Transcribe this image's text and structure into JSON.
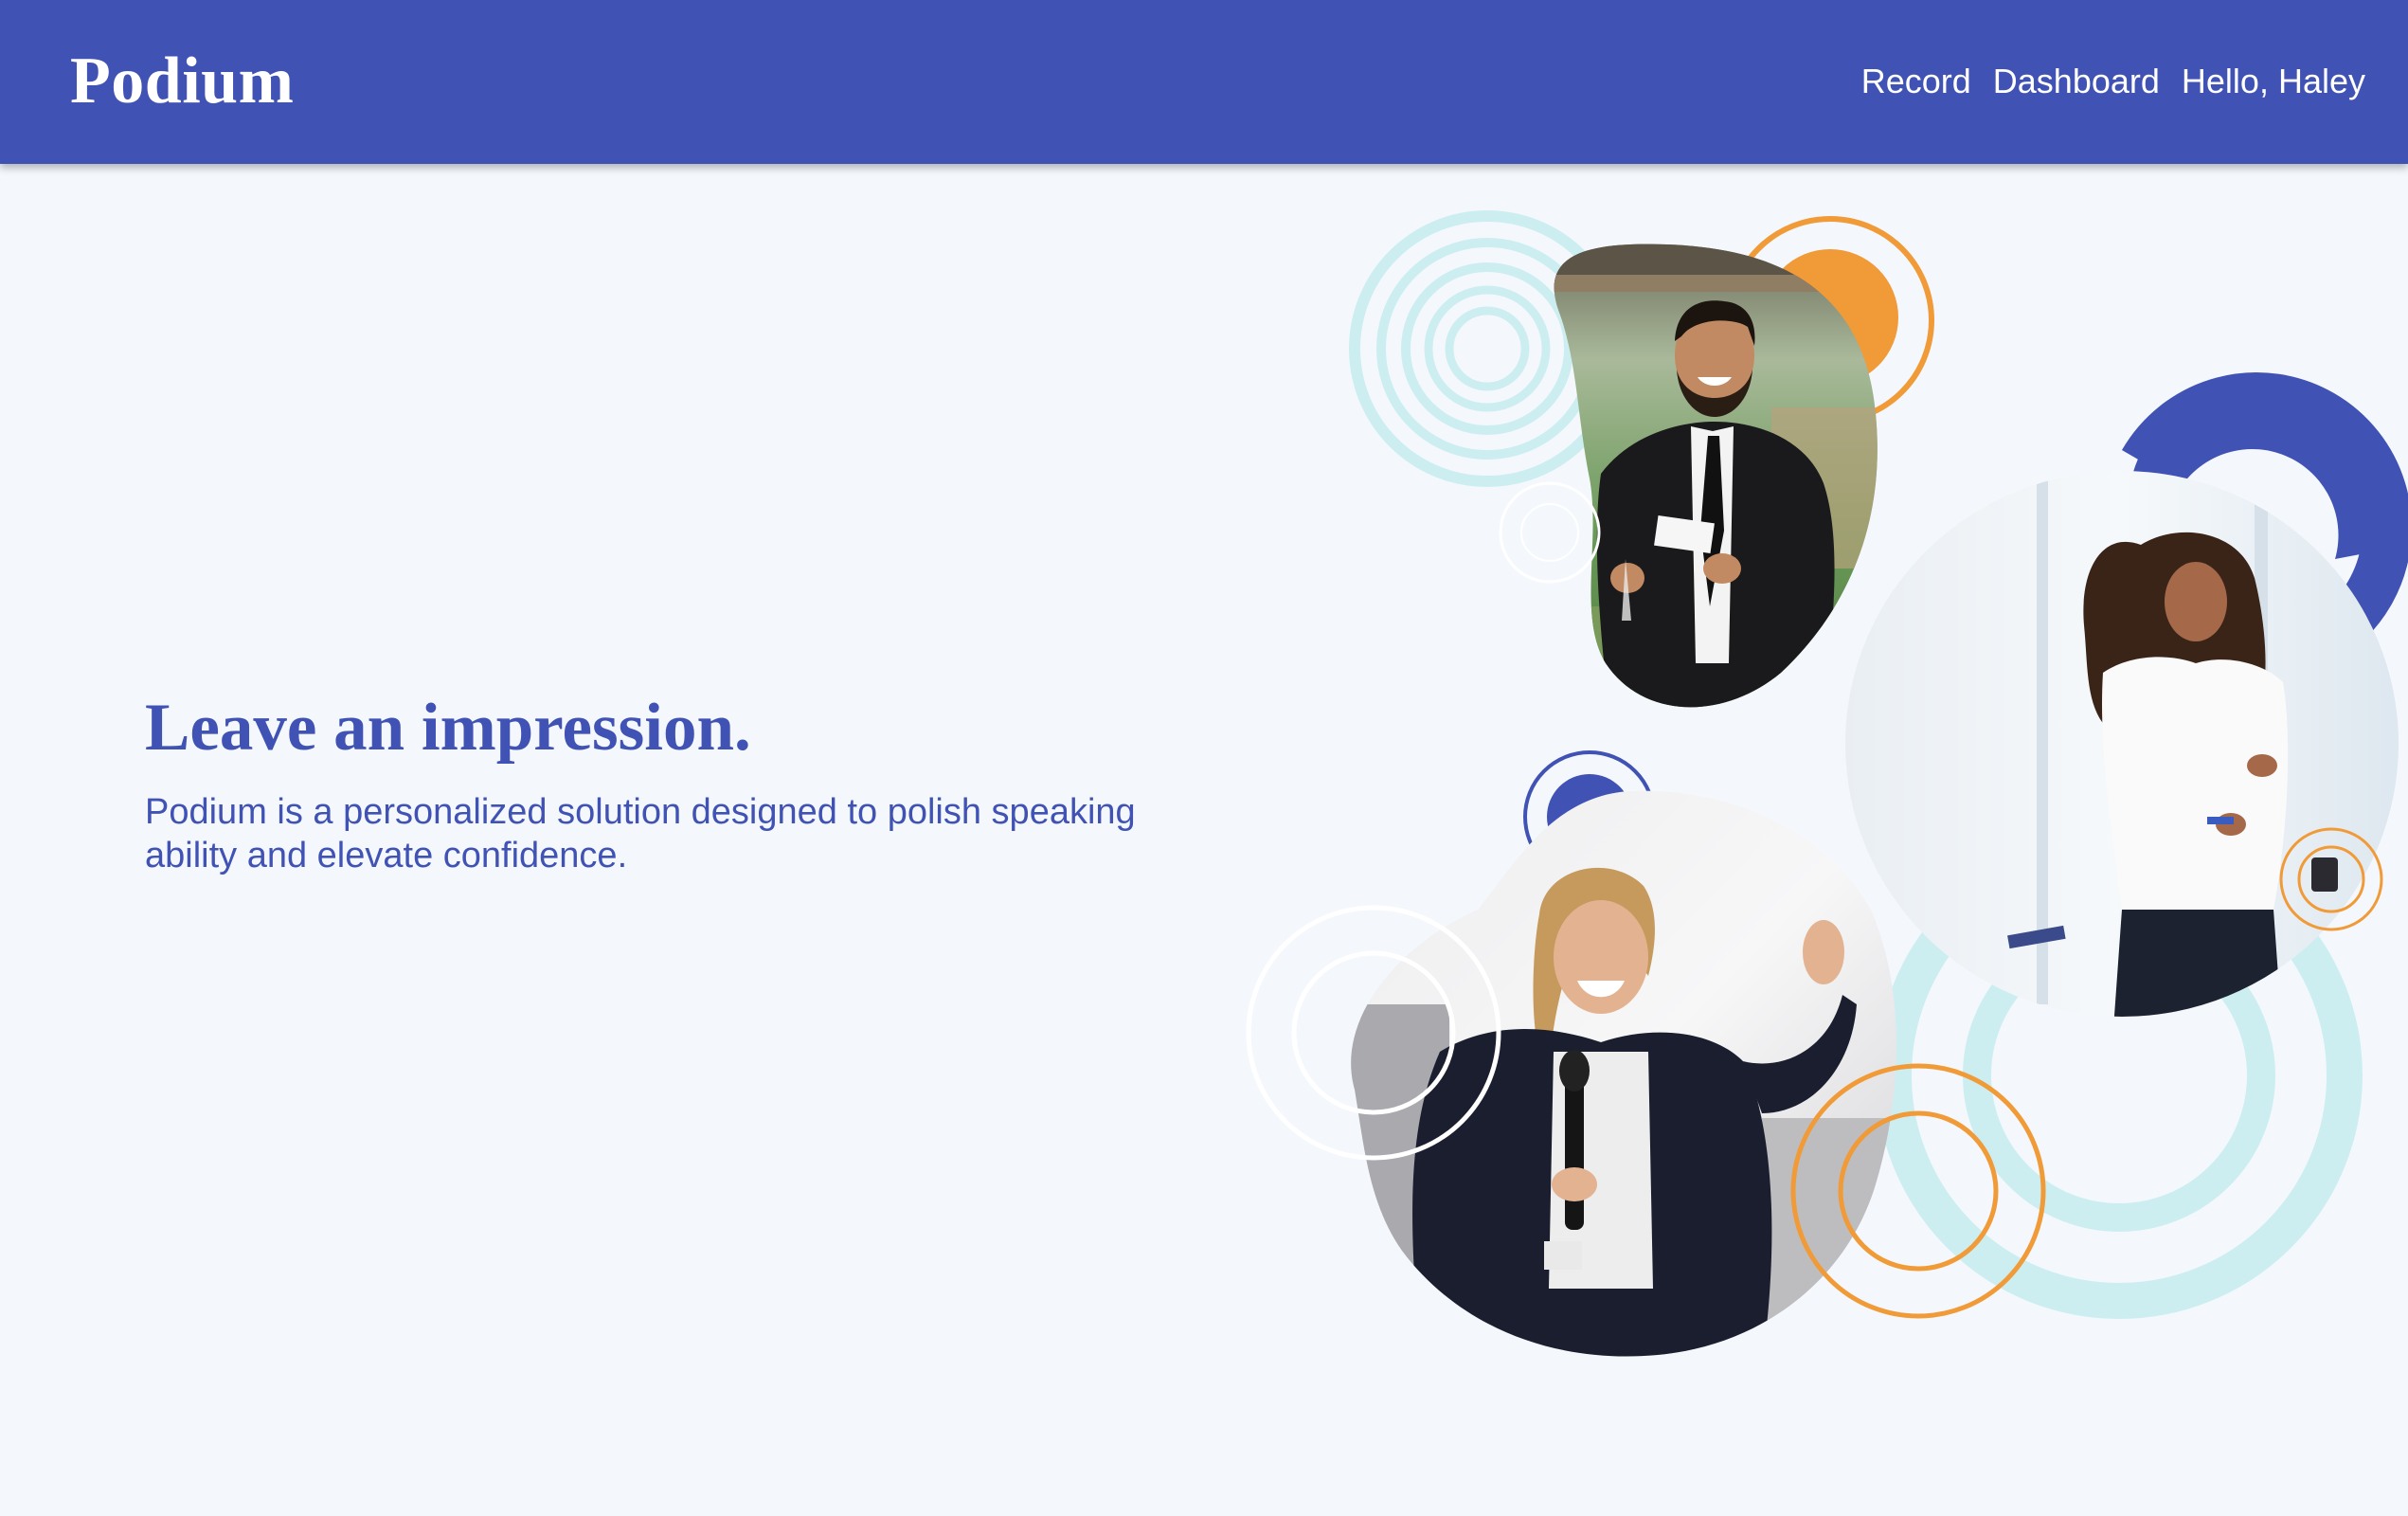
{
  "app": {
    "brand": "Podium"
  },
  "nav": {
    "items": [
      {
        "label": "Record"
      },
      {
        "label": "Dashboard"
      },
      {
        "label": "Hello, Haley"
      }
    ]
  },
  "hero": {
    "title": "Leave an impression.",
    "description": "Podium is a personalized solution designed to polish speaking ability and elevate confidence."
  },
  "theme": {
    "primary": "#4052b4",
    "background": "#f4f8fc",
    "accent_orange": "#f09a38",
    "accent_teal": "#cdeef0",
    "text_on_primary": "#ffffff"
  },
  "images": [
    {
      "name": "man-speaker-photo",
      "depicts": "smiling man in suit holding glass and paper"
    },
    {
      "name": "woman-presenter-photo",
      "depicts": "woman in white blouse presenting"
    },
    {
      "name": "woman-microphone-photo",
      "depicts": "woman with microphone waving"
    }
  ]
}
